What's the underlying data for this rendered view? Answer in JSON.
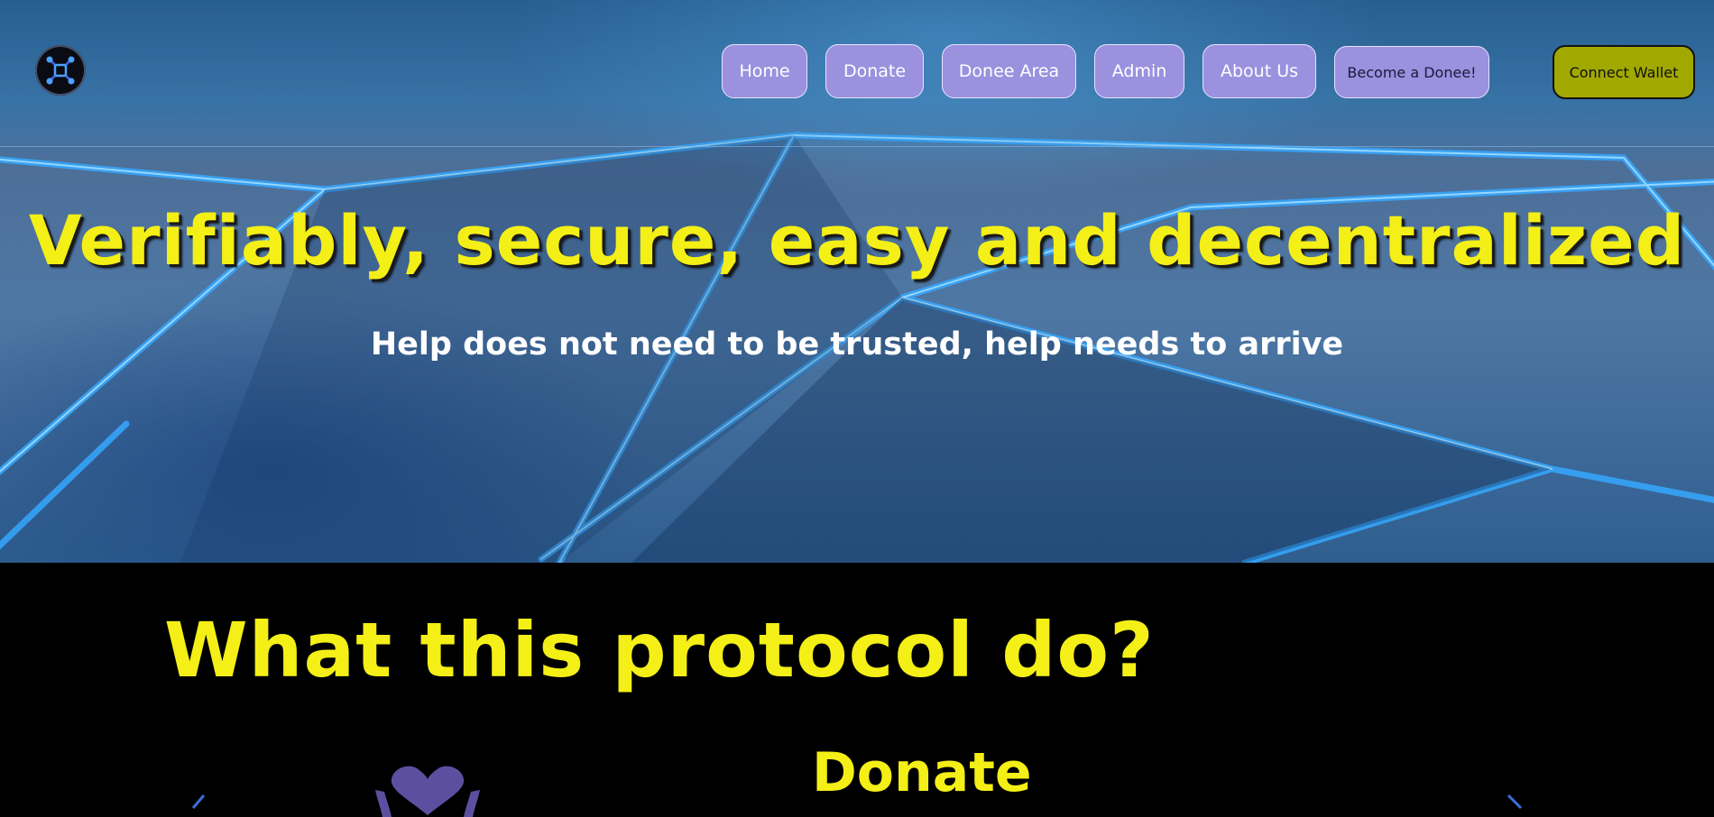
{
  "nav": {
    "logo_icon": "network-node-icon",
    "items": [
      {
        "label": "Home"
      },
      {
        "label": "Donate"
      },
      {
        "label": "Donee Area"
      },
      {
        "label": "Admin"
      },
      {
        "label": "About Us"
      },
      {
        "label": "Become a Donee!"
      }
    ],
    "connect_wallet": "Connect Wallet"
  },
  "hero": {
    "title": "Verifiably, secure, easy and decentralized",
    "subtitle": "Help does not need to be trusted, help needs to arrive"
  },
  "protocol": {
    "heading": "What this protocol do?",
    "card_title": "Donate",
    "card_icon": "heart-hands-icon"
  },
  "colors": {
    "accent_yellow": "#f4ef16",
    "nav_button": "#9b91df",
    "wallet_button": "#a1a800",
    "icon_purple": "#5d4fa0"
  }
}
